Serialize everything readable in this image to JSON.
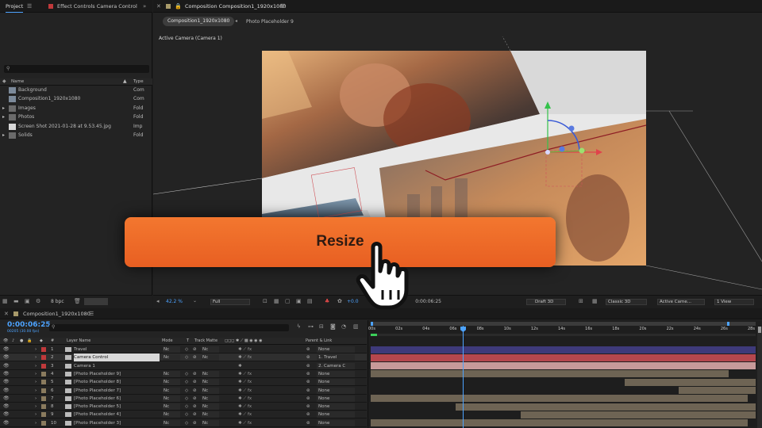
{
  "project_panel": {
    "tab_label": "Project",
    "effect_controls_label": "Effect Controls Camera Control",
    "search_placeholder": "",
    "col_name": "Name",
    "col_type": "Type",
    "items": [
      {
        "name": "Background",
        "type": "Com",
        "icon": "comp"
      },
      {
        "name": "Composition1_1920x1080",
        "type": "Com",
        "icon": "comp"
      },
      {
        "name": "Images",
        "type": "Fold",
        "icon": "folder"
      },
      {
        "name": "Photos",
        "type": "Fold",
        "icon": "folder"
      },
      {
        "name": "Screen Shot 2021-01-28 at 9.53.45.jpg",
        "type": "Imp",
        "icon": "file"
      },
      {
        "name": "Solids",
        "type": "Fold",
        "icon": "folder"
      }
    ],
    "bpc": "8 bpc"
  },
  "composition_panel": {
    "tab_label": "Composition Composition1_1920x1080",
    "sub_tabs": [
      "Composition1_1920x1080",
      "Photo Placeholder 9"
    ],
    "view_label": "Active Camera (Camera 1)",
    "zoom": "42.2 %",
    "resolution": "Full",
    "exposure": "+0.0",
    "timecode": "0:00:06:25",
    "renderer_label": "Draft 3D",
    "renderer": "Classic 3D",
    "camera": "Active Came...",
    "views": "1 View"
  },
  "overlay": {
    "button_label": "Resize",
    "color": "#f06a2a"
  },
  "timeline": {
    "tab_label": "Composition1_1920x1080",
    "timecode": "0:00:06:25",
    "fps": "00205 (30.00 fps)",
    "col_layer_name": "Layer Name",
    "col_mode": "Mode",
    "col_t": "T",
    "col_track_matte": "Track Matte",
    "col_parent": "Parent & Link",
    "ruler": [
      "00s",
      "02s",
      "04s",
      "06s",
      "08s",
      "10s",
      "12s",
      "14s",
      "16s",
      "18s",
      "20s",
      "22s",
      "24s",
      "26s",
      "28s"
    ],
    "layers": [
      {
        "num": "1",
        "name": "Travel",
        "label_color": "#c0393b",
        "mode": "Nc",
        "matte": "Nc",
        "parent": "None",
        "bar_start": 0,
        "bar_end": 1,
        "bar_color": "#3e3a7a"
      },
      {
        "num": "2",
        "name": "Camera Control",
        "label_color": "#c0393b",
        "mode": "Nc",
        "matte": "Nc",
        "parent": "1. Travel",
        "bar_start": 0,
        "bar_end": 1,
        "bar_color": "#b5474e"
      },
      {
        "num": "3",
        "name": "Camera 1",
        "label_color": "#c0393b",
        "mode": "",
        "matte": "",
        "parent": "2. Camera C",
        "bar_start": 0,
        "bar_end": 1,
        "bar_color": "#c79a9a"
      },
      {
        "num": "4",
        "name": "[Photo Placeholder 9]",
        "label_color": "#8a7b5e",
        "mode": "Nc",
        "matte": "Nc",
        "parent": "None",
        "bar_start": 0,
        "bar_end": 0.93,
        "bar_color": "#6e6454"
      },
      {
        "num": "5",
        "name": "[Photo Placeholder 8]",
        "label_color": "#8a7b5e",
        "mode": "Nc",
        "matte": "Nc",
        "parent": "None",
        "bar_start": 0.66,
        "bar_end": 1,
        "bar_color": "#6e6454"
      },
      {
        "num": "6",
        "name": "[Photo Placeholder 7]",
        "label_color": "#8a7b5e",
        "mode": "Nc",
        "matte": "Nc",
        "parent": "None",
        "bar_start": 0.8,
        "bar_end": 1,
        "bar_color": "#6e6454"
      },
      {
        "num": "7",
        "name": "[Photo Placeholder 6]",
        "label_color": "#8a7b5e",
        "mode": "Nc",
        "matte": "Nc",
        "parent": "None",
        "bar_start": 0,
        "bar_end": 0.98,
        "bar_color": "#6e6454"
      },
      {
        "num": "8",
        "name": "[Photo Placeholder 5]",
        "label_color": "#8a7b5e",
        "mode": "Nc",
        "matte": "Nc",
        "parent": "None",
        "bar_start": 0.22,
        "bar_end": 1,
        "bar_color": "#6e6454"
      },
      {
        "num": "9",
        "name": "[Photo Placeholder 4]",
        "label_color": "#8a7b5e",
        "mode": "Nc",
        "matte": "Nc",
        "parent": "None",
        "bar_start": 0.39,
        "bar_end": 1,
        "bar_color": "#6e6454"
      },
      {
        "num": "10",
        "name": "[Photo Placeholder 3]",
        "label_color": "#8a7b5e",
        "mode": "Nc",
        "matte": "Nc",
        "parent": "None",
        "bar_start": 0,
        "bar_end": 0.98,
        "bar_color": "#6e6454"
      }
    ]
  }
}
